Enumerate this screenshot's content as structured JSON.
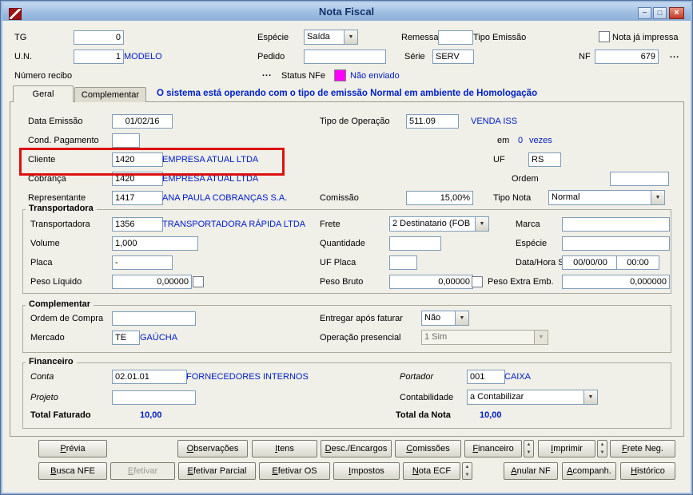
{
  "window": {
    "title": "Nota Fiscal"
  },
  "icons": {
    "minimize": "−",
    "maximize": "□",
    "close": "×",
    "dropdown": "▼",
    "spin_up": "▲",
    "spin_down": "▼"
  },
  "colors": {
    "accent_blue": "#0020C8",
    "status_magenta": "#FF00FF",
    "annotation_red": "#DE1010",
    "titlebar_blue": "#9FBEE2"
  },
  "header": {
    "tg_label": "TG",
    "tg_value": "0",
    "especie_label": "Espécie",
    "especie_value": "Saída",
    "remessa_label": "Remessa",
    "remessa_value": "",
    "tipo_emissao_label": "Tipo Emissão",
    "nota_ja_impressa_label": "Nota já impressa",
    "un_label": "U.N.",
    "un_value": "1",
    "un_desc": "MODELO",
    "pedido_label": "Pedido",
    "pedido_value": "",
    "serie_label": "Série",
    "serie_value": "SERV",
    "nf_label": "NF",
    "nf_value": "679",
    "nf_more": "...",
    "numero_recibo_label": "Número recibo",
    "recibo_more": "...",
    "status_nfe_label": "Status NFe",
    "status_nfe_value": "Não enviado"
  },
  "tabs": {
    "geral": "Geral",
    "complementar": "Complementar",
    "message": "O sistema está operando com o tipo de emissão Normal em ambiente de Homologação"
  },
  "geral": {
    "data_emissao_label": "Data Emissão",
    "data_emissao_value": "01/02/16",
    "tipo_operacao_label": "Tipo de Operação",
    "tipo_operacao_value": "511.09",
    "tipo_operacao_desc": "VENDA ISS",
    "cond_pagamento_label": "Cond. Pagamento",
    "cond_pagamento_value": "",
    "em_label": "em",
    "em_value": "0",
    "vezes_label": "vezes",
    "cliente_label": "Cliente",
    "cliente_value": "1420",
    "cliente_desc": "EMPRESA ATUAL LTDA",
    "uf_label": "UF",
    "uf_value": "RS",
    "cobranca_label": "Cobrança",
    "cobranca_value": "1420",
    "cobranca_desc": "EMPRESA ATUAL LTDA",
    "ordem_label": "Ordem",
    "ordem_value": "",
    "representante_label": "Representante",
    "representante_value": "1417",
    "representante_desc": "ANA PAULA COBRANÇAS S.A.",
    "comissao_label": "Comissão",
    "comissao_value": "15,00%",
    "tipo_nota_label": "Tipo Nota",
    "tipo_nota_value": "Normal"
  },
  "transportadora": {
    "group_label": "Transportadora",
    "transportadora_label": "Transportadora",
    "transportadora_value": "1356",
    "transportadora_desc": "TRANSPORTADORA RÁPIDA LTDA",
    "frete_label": "Frete",
    "frete_value": "2 Destinatario (FOB",
    "marca_label": "Marca",
    "marca_value": "",
    "volume_label": "Volume",
    "volume_value": "1,000",
    "quantidade_label": "Quantidade",
    "quantidade_value": "",
    "especie_label": "Espécie",
    "especie_value": "",
    "placa_label": "Placa",
    "placa_value": "-",
    "uf_placa_label": "UF Placa",
    "uf_placa_value": "",
    "data_hora_label": "Data/Hora Saída",
    "data_value": "00/00/00",
    "hora_value": "00:00",
    "peso_liquido_label": "Peso Líquido",
    "peso_liquido_value": "0,00000",
    "peso_bruto_label": "Peso Bruto",
    "peso_bruto_value": "0,00000",
    "peso_extra_label": "Peso Extra Emb.",
    "peso_extra_value": "0,000000"
  },
  "complementar": {
    "group_label": "Complementar",
    "ordem_compra_label": "Ordem de Compra",
    "ordem_compra_value": "",
    "entregar_label": "Entregar após faturar",
    "entregar_value": "Não",
    "mercado_label": "Mercado",
    "mercado_value": "TE",
    "mercado_desc": "GAÚCHA",
    "operacao_label": "Operação presencial",
    "operacao_value": "1 Sim"
  },
  "financeiro": {
    "group_label": "Financeiro",
    "conta_label": "Conta",
    "conta_value": "02.01.01",
    "conta_desc": "FORNECEDORES INTERNOS",
    "portador_label": "Portador",
    "portador_value": "001",
    "portador_desc": "CAIXA",
    "projeto_label": "Projeto",
    "projeto_value": "",
    "contabilidade_label": "Contabilidade",
    "contabilidade_value": "a Contabilizar",
    "total_faturado_label": "Total Faturado",
    "total_faturado_value": "10,00",
    "total_nota_label": "Total da Nota",
    "total_nota_value": "10,00"
  },
  "buttons": {
    "row1": [
      {
        "label": "Prévia"
      },
      {
        "label": "Observações"
      },
      {
        "label": "Itens"
      },
      {
        "label": "Desc./Encargos"
      },
      {
        "label": "Comissões"
      },
      {
        "label": "Financeiro"
      },
      {
        "label": "Imprimir"
      },
      {
        "label": "Frete Neg."
      }
    ],
    "row2": [
      {
        "label": "Busca NFE"
      },
      {
        "label": "Efetivar"
      },
      {
        "label": "Efetivar Parcial"
      },
      {
        "label": "Efetivar OS"
      },
      {
        "label": "Impostos"
      },
      {
        "label": "Nota ECF"
      },
      {
        "label": "Anular NF"
      },
      {
        "label": "Acompanh."
      },
      {
        "label": "Histórico"
      }
    ]
  }
}
